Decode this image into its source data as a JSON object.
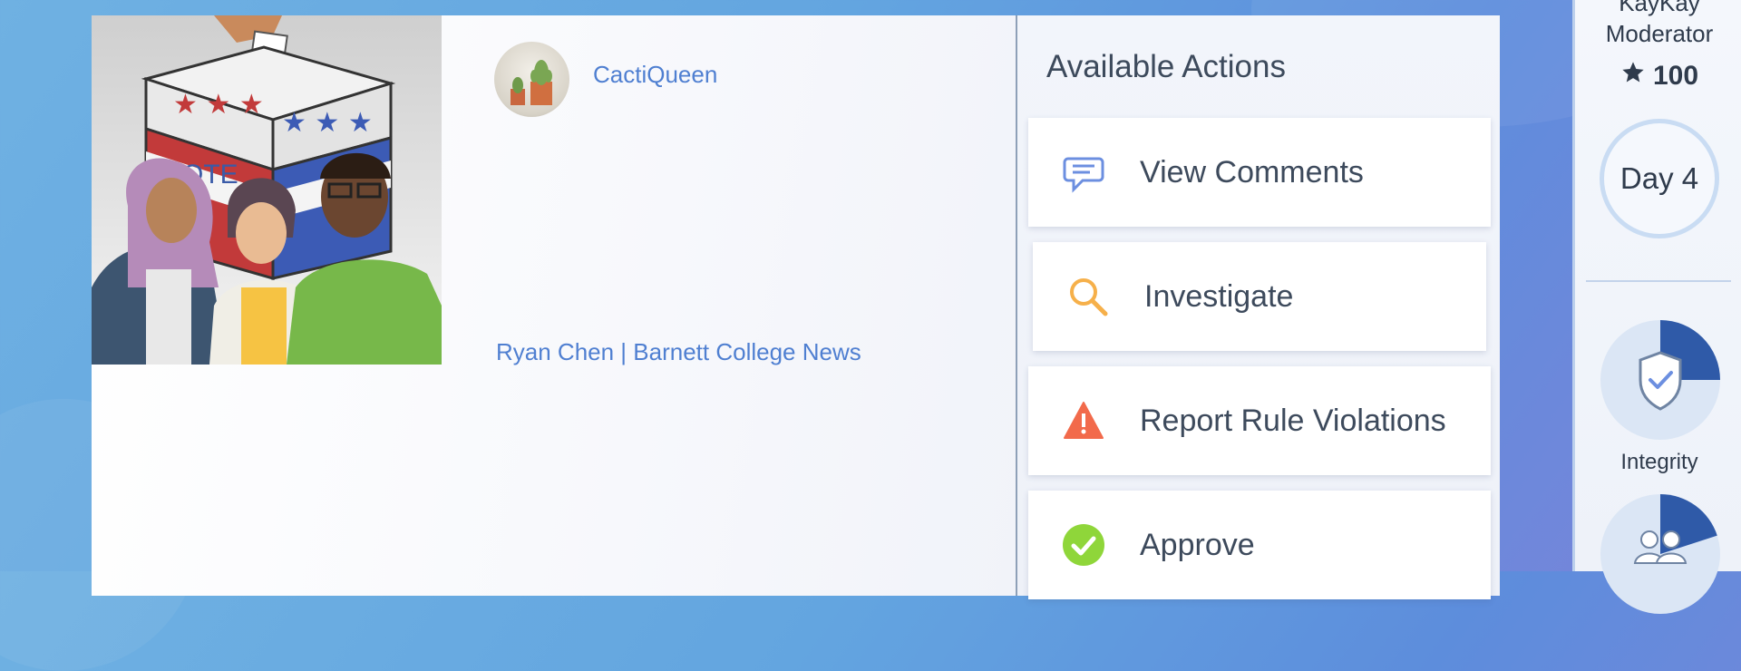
{
  "post": {
    "author": "CactiQueen",
    "byline": "Ryan Chen | Barnett College News",
    "image_ballot_text": "VOTE"
  },
  "actions_panel": {
    "title": "Available Actions",
    "items": [
      {
        "label": "View Comments",
        "icon": "speech-bubble-icon"
      },
      {
        "label": "Investigate",
        "icon": "magnifier-icon"
      },
      {
        "label": "Report Rule Violations",
        "icon": "warning-icon"
      },
      {
        "label": "Approve",
        "icon": "checkmark-icon"
      }
    ]
  },
  "player": {
    "name": "KayKay",
    "role": "Moderator",
    "score": "100",
    "day": "Day 4",
    "meters": [
      {
        "label": "Integrity",
        "icon": "shield-check-icon",
        "level": 0.25
      },
      {
        "label": "",
        "icon": "users-icon",
        "level": 0.2
      }
    ]
  },
  "colors": {
    "link": "#4f7fd1",
    "meter_fill": "#2f5aa8",
    "warning": "#f26a4b",
    "approve": "#8fd63a",
    "investigate": "#f6b04a",
    "comments": "#6c8fe0"
  }
}
